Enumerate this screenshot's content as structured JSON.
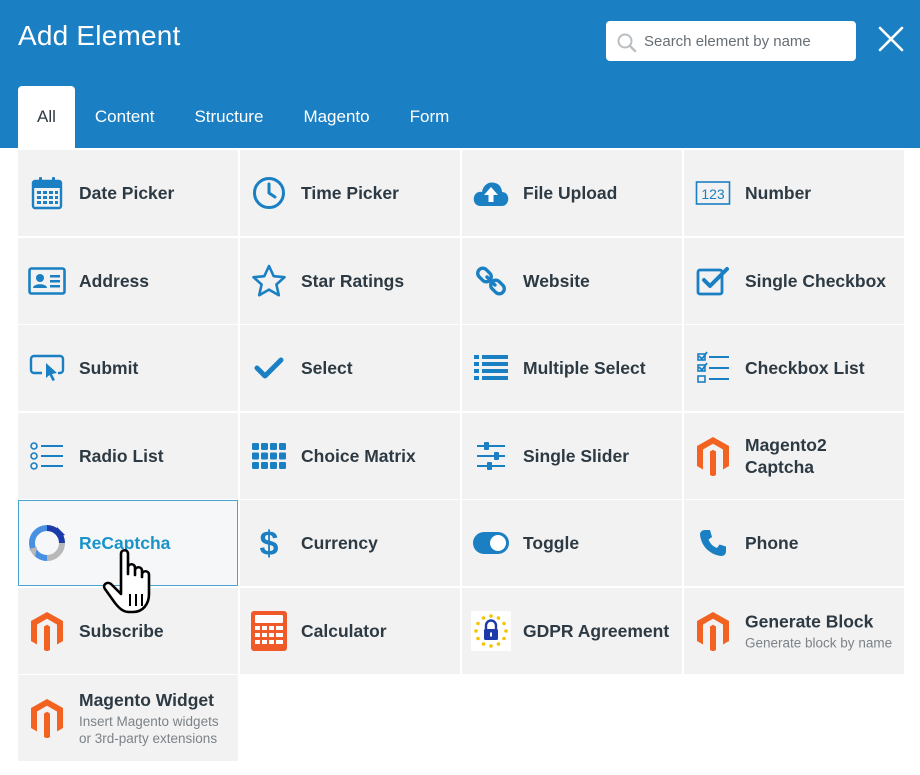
{
  "dialog": {
    "title": "Add Element"
  },
  "search": {
    "placeholder": "Search element by name"
  },
  "tabs": [
    {
      "label": "All"
    },
    {
      "label": "Content"
    },
    {
      "label": "Structure"
    },
    {
      "label": "Magento"
    },
    {
      "label": "Form"
    }
  ],
  "elements": [
    {
      "label": "Date Picker",
      "icon": "calendar-icon"
    },
    {
      "label": "Time Picker",
      "icon": "clock-icon"
    },
    {
      "label": "File Upload",
      "icon": "cloud-upload-icon"
    },
    {
      "label": "Number",
      "icon": "number-123-icon"
    },
    {
      "label": "Address",
      "icon": "address-card-icon"
    },
    {
      "label": "Star Ratings",
      "icon": "star-icon"
    },
    {
      "label": "Website",
      "icon": "link-icon"
    },
    {
      "label": "Single Checkbox",
      "icon": "checkbox-icon"
    },
    {
      "label": "Submit",
      "icon": "submit-pointer-icon"
    },
    {
      "label": "Select",
      "icon": "checkmark-icon"
    },
    {
      "label": "Multiple Select",
      "icon": "list-icon"
    },
    {
      "label": "Checkbox List",
      "icon": "checkbox-list-icon"
    },
    {
      "label": "Radio List",
      "icon": "radio-list-icon"
    },
    {
      "label": "Choice Matrix",
      "icon": "grid-icon"
    },
    {
      "label": "Single Slider",
      "icon": "sliders-icon"
    },
    {
      "label": "Magento2 Captcha",
      "icon": "magento-logo-icon"
    },
    {
      "label": "ReCaptcha",
      "icon": "recaptcha-icon"
    },
    {
      "label": "Currency",
      "icon": "dollar-icon"
    },
    {
      "label": "Toggle",
      "icon": "toggle-icon"
    },
    {
      "label": "Phone",
      "icon": "phone-icon"
    },
    {
      "label": "Subscribe",
      "icon": "magento-logo-icon"
    },
    {
      "label": "Calculator",
      "icon": "calculator-icon"
    },
    {
      "label": "GDPR Agreement",
      "icon": "gdpr-lock-icon"
    },
    {
      "label": "Generate Block",
      "description": "Generate block by name",
      "icon": "magento-logo-icon"
    },
    {
      "label": "Magento Widget",
      "description": "Insert Magento widgets or 3rd-party extensions",
      "icon": "magento-logo-icon"
    }
  ],
  "colors": {
    "header": "#1a7fc3",
    "icon": "#1a7fc3",
    "magento": "#f26322",
    "hover_border": "#4aa3cf",
    "cell": "#f2f2f2"
  }
}
